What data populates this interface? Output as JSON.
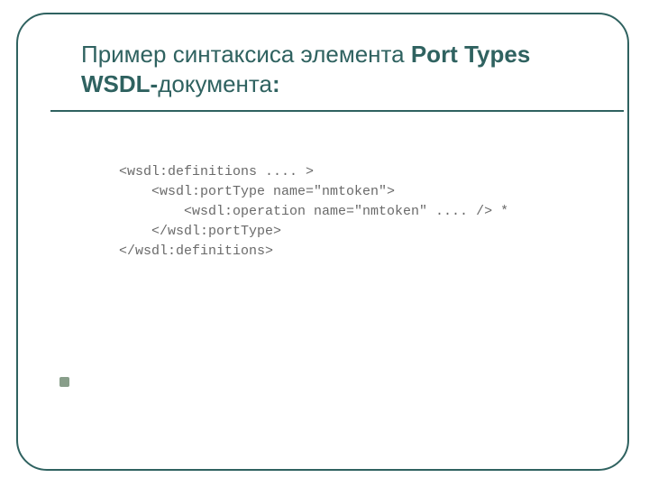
{
  "title": {
    "prefix": " Пример синтаксиса элемента ",
    "bold": "Port Types WSDL-",
    "suffix": "документа",
    "colon": ":"
  },
  "code": {
    "line1": "<wsdl:definitions .... >",
    "line2": "    <wsdl:portType name=\"nmtoken\">",
    "line3": "        <wsdl:operation name=\"nmtoken\" .... /> *",
    "line4": "    </wsdl:portType>",
    "line5": "</wsdl:definitions>"
  }
}
